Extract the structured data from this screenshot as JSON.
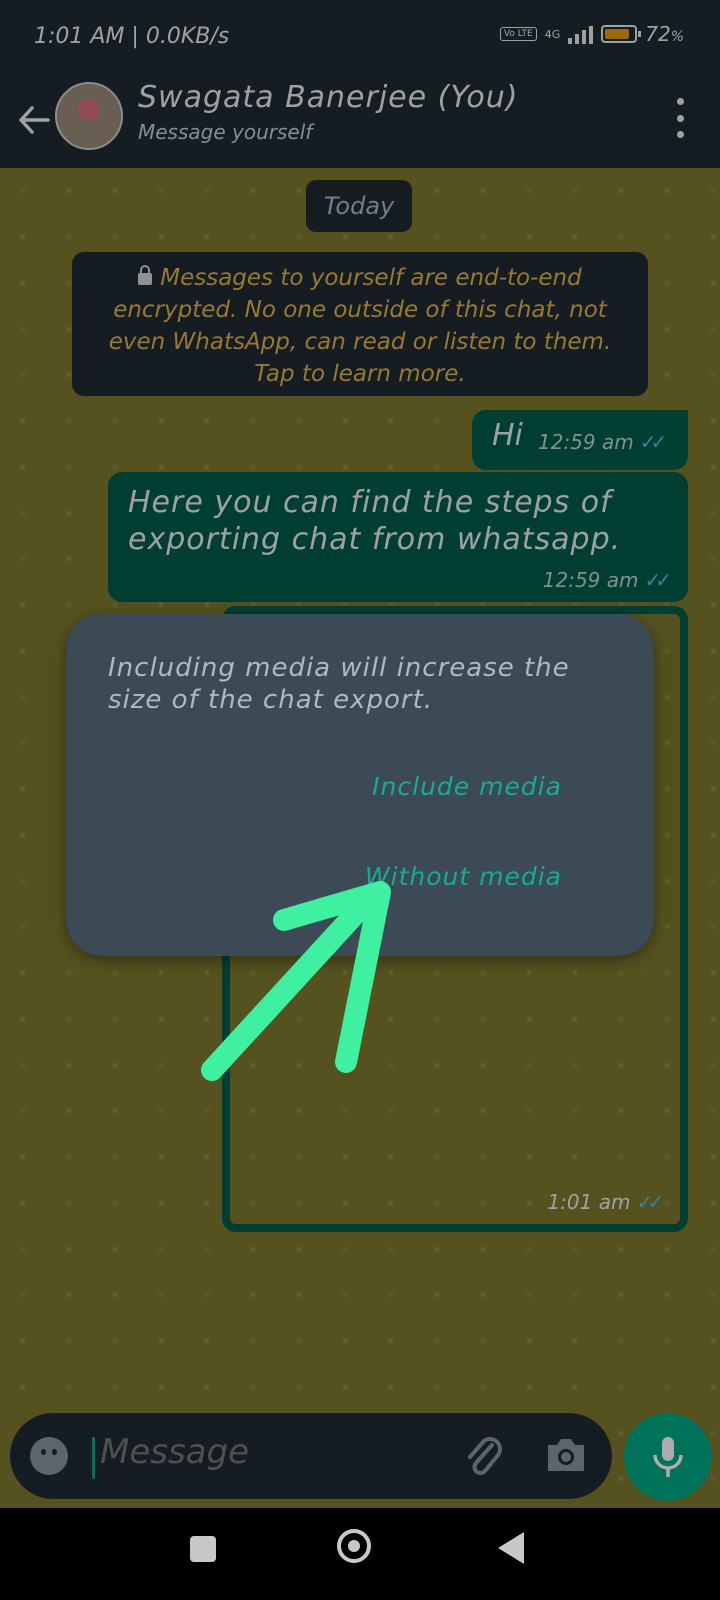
{
  "status_bar": {
    "time": "1:01 AM | 0.0KB/s",
    "volte": "Vo LTE",
    "network": "4G",
    "battery": "72"
  },
  "header": {
    "name": "Swagata Banerjee (You)",
    "subtitle": "Message yourself"
  },
  "chat": {
    "day_label": "Today",
    "encryption_notice": "Messages to yourself are end-to-end encrypted. No one outside of this chat, not even WhatsApp, can read or listen to them. Tap to learn more.",
    "messages": [
      {
        "text": "Hi",
        "time": "12:59 am"
      },
      {
        "text": "Here you can find the steps of exporting chat from whatsapp.",
        "time": "12:59 am"
      },
      {
        "text": "",
        "time": "1:01 am"
      }
    ]
  },
  "dialog": {
    "message": "Including media will increase the size of the chat export.",
    "include_label": "Include media",
    "without_label": "Without media"
  },
  "composer": {
    "placeholder": "Message"
  },
  "colors": {
    "accent": "#00a884",
    "dialog_button": "#16ac92",
    "annotation_arrow": "#3ef0a0",
    "chat_background": "#7e7a2e"
  }
}
